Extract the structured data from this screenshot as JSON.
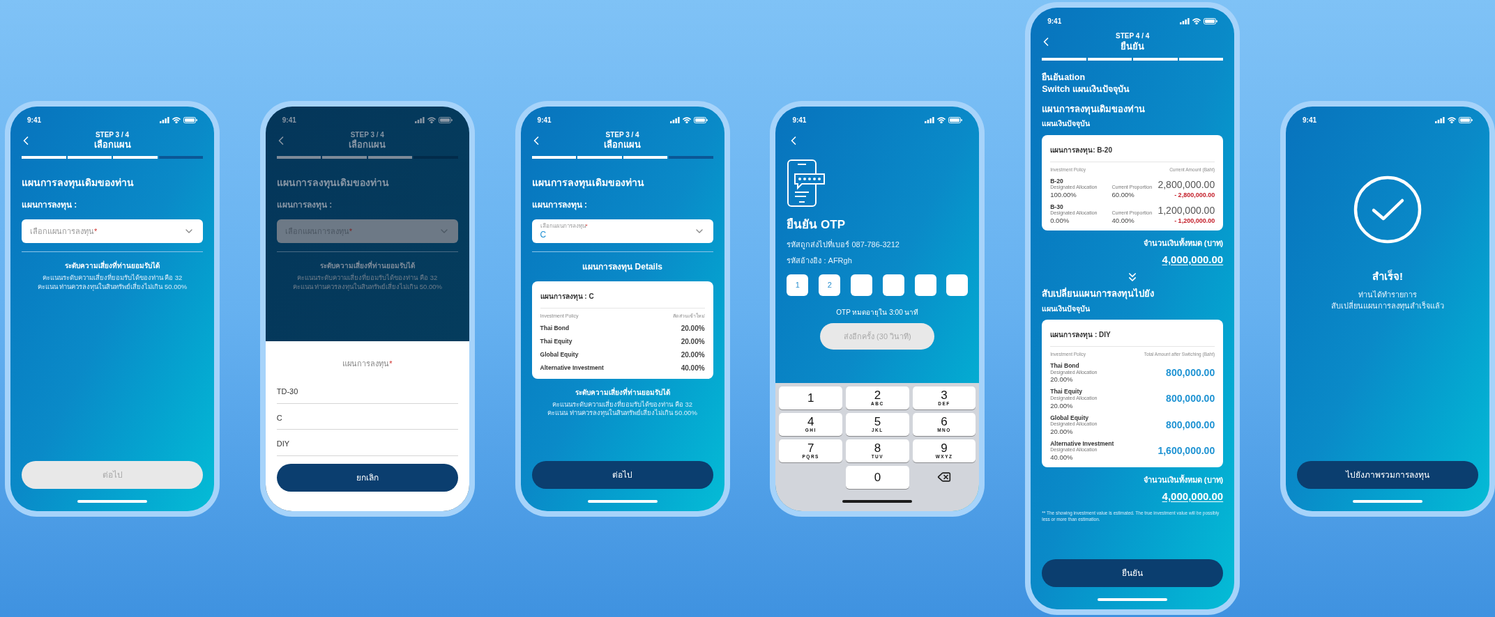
{
  "screens": [
    {
      "kind": "select_plan",
      "dimmed": false,
      "time": "9:41",
      "step": "STEP 3 / 4",
      "title": "เลือกแผน",
      "progress": [
        {
          "done": true
        },
        {
          "done": true
        },
        {
          "done": true
        },
        {
          "done": false
        }
      ],
      "heading": "แผนการลงทุนเดิมของท่าน",
      "field_label": "แผนการลงทุน :",
      "select": {
        "placeholder": "เลือกแผนการลงทุน",
        "required_mark": "*"
      },
      "risk": {
        "title": "ระดับความเสี่ยงที่ท่านยอมรับได้",
        "lines": [
          "คะแนนระดับความเสี่ยงที่ยอมรับได้ของท่าน คือ 32",
          "คะแนน ท่านควรลงทุนในสินทรัพย์เสี่ยงไม่เกิน 50.00%"
        ]
      },
      "button": {
        "label": "ต่อไป",
        "disabled": true
      }
    },
    {
      "kind": "select_plan",
      "dimmed": true,
      "time": "9:41",
      "step": "STEP 3 / 4",
      "title": "เลือกแผน",
      "progress": [
        {
          "done": true
        },
        {
          "done": true
        },
        {
          "done": true
        },
        {
          "done": false
        }
      ],
      "heading": "แผนการลงทุนเดิมของท่าน",
      "field_label": "แผนการลงทุน :",
      "select": {
        "placeholder": "เลือกแผนการลงทุน",
        "required_mark": "*"
      },
      "risk": {
        "title": "ระดับความเสี่ยงที่ท่านยอมรับได้",
        "lines": [
          "คะแนนระดับความเสี่ยงที่ยอมรับได้ของท่าน คือ 32",
          "คะแนน ท่านควรลงทุนในสินทรัพย์เสี่ยงไม่เกิน 50.00%"
        ]
      },
      "sheet": {
        "title": "แผนการลงทุน",
        "required_mark": "*",
        "options": [
          "TD-30",
          "C",
          "DIY"
        ],
        "cancel": "ยกเลิก"
      }
    },
    {
      "kind": "select_plan",
      "dimmed": false,
      "time": "9:41",
      "step": "STEP 3 / 4",
      "title": "เลือกแผน",
      "progress": [
        {
          "done": true
        },
        {
          "done": true
        },
        {
          "done": true
        },
        {
          "done": false
        }
      ],
      "heading": "แผนการลงทุนเดิมของท่าน",
      "field_label": "แผนการลงทุน :",
      "select": {
        "placeholder": "เลือกแผนการลงทุน",
        "required_mark": "*",
        "value": "C"
      },
      "details": {
        "heading": "แผนการลงทุน Details",
        "card_title": "แผนการลงทุน :  C",
        "columns": [
          "Investment Policy",
          "สัดส่วนเข้าใหม่"
        ],
        "rows": [
          {
            "name": "Thai Bond",
            "value": "20.00%"
          },
          {
            "name": "Thai Equity",
            "value": "20.00%"
          },
          {
            "name": "Global Equity",
            "value": "20.00%"
          },
          {
            "name": "Alternative Investment",
            "value": "40.00%"
          }
        ]
      },
      "risk": {
        "title": "ระดับความเสี่ยงที่ท่านยอมรับได้",
        "lines": [
          "คะแนนระดับความเสี่ยงที่ยอมรับได้ของท่าน คือ 32",
          "คะแนน ท่านควรลงทุนในสินทรัพย์เสี่ยงไม่เกิน 50.00%"
        ]
      },
      "button": {
        "label": "ต่อไป",
        "disabled": false
      }
    },
    {
      "kind": "otp",
      "time": "9:41",
      "title": "ยืนยัน OTP",
      "sent_to": "รหัสถูกส่งไปที่เบอร์ 087-786-3212",
      "reference": "รหัสอ้างอิง : AFRgh",
      "otp_boxes": [
        {
          "kind": "digit",
          "digit": "1"
        },
        {
          "kind": "digit",
          "digit": "2"
        },
        {
          "kind": "blank"
        },
        {
          "kind": "blank"
        },
        {
          "kind": "blank"
        },
        {
          "kind": "blank"
        }
      ],
      "expiry": "OTP หมดอายุใน 3:00 นาที",
      "resend": {
        "label": "ส่งอีกครั้ง (30 วินาที)",
        "disabled": true
      },
      "keys": [
        {
          "kind": "digit",
          "digit": "1"
        },
        {
          "kind": "digit",
          "digit": "2",
          "letters": "ABC"
        },
        {
          "kind": "digit",
          "digit": "3",
          "letters": "DEF"
        },
        {
          "kind": "digit",
          "digit": "4",
          "letters": "GHI"
        },
        {
          "kind": "digit",
          "digit": "5",
          "letters": "JKL"
        },
        {
          "kind": "digit",
          "digit": "6",
          "letters": "MNO"
        },
        {
          "kind": "digit",
          "digit": "7",
          "letters": "PQRS"
        },
        {
          "kind": "digit",
          "digit": "8",
          "letters": "TUV"
        },
        {
          "kind": "digit",
          "digit": "9",
          "letters": "WXYZ"
        },
        {
          "kind": "empty"
        },
        {
          "kind": "digit",
          "digit": "0"
        },
        {
          "kind": "backspace"
        }
      ]
    },
    {
      "kind": "confirm",
      "time": "9:41",
      "step": "STEP 4 / 4",
      "title": "ยืนยัน",
      "progress": [
        {
          "done": true
        },
        {
          "done": true
        },
        {
          "done": true
        },
        {
          "done": true
        }
      ],
      "intro_lines": [
        "ยืนยันation",
        "Switch แผนเงินปัจจุบัน"
      ],
      "current": {
        "heading": "แผนการลงทุนเดิมของท่าน",
        "subheading": "แผนเงินปัจจุบัน",
        "card_title": "แผนการลงทุน: B-20",
        "columns": [
          "Investment Policy",
          "Current Amount (Baht)"
        ],
        "rows": [
          {
            "name": "B-20",
            "alloc_label": "Designated Allocation",
            "alloc": "100.00%",
            "prop_label": "Current Proportion",
            "prop": "60.00%",
            "amount": "2,800,000.00",
            "deduction": "- 2,800,000.00"
          },
          {
            "name": "B-30",
            "alloc_label": "Designated Allocation",
            "alloc": "0.00%",
            "prop_label": "Current Proportion",
            "prop": "40.00%",
            "amount": "1,200,000.00",
            "deduction": "- 1,200,000.00"
          }
        ],
        "total_label": "จำนวนเงินทั้งหมด (บาท)",
        "total": "4,000,000.00"
      },
      "target": {
        "heading": "สับเปลี่ยนแผนการลงทุนไปยัง",
        "subheading": "แผนเงินปัจจุบัน",
        "card_title": "แผนการลงทุน :  DIY",
        "columns": [
          "Investment Policy",
          "Total Amount after Switching (Baht)"
        ],
        "rows": [
          {
            "name": "Thai Bond",
            "alloc_label": "Designated Allocation",
            "alloc": "20.00%",
            "amount": "800,000.00"
          },
          {
            "name": "Thai Equity",
            "alloc_label": "Designated Allocation",
            "alloc": "20.00%",
            "amount": "800,000.00"
          },
          {
            "name": "Global Equity",
            "alloc_label": "Designated Allocation",
            "alloc": "20.00%",
            "amount": "800,000.00"
          },
          {
            "name": "Alternative Investment",
            "alloc_label": "Designated Allocation",
            "alloc": "40.00%",
            "amount": "1,600,000.00"
          }
        ],
        "total_label": "จำนวนเงินทั้งหมด (บาท)",
        "total": "4,000,000.00"
      },
      "note": "** The showing investment value is estimated. The true investment value will be possibly less or more than estimation.",
      "button": {
        "label": "ยืนยัน",
        "disabled": false
      }
    },
    {
      "kind": "success",
      "time": "9:41",
      "title": "สำเร็จ!",
      "lines": [
        "ท่านได้ทำรายการ",
        "สับเปลี่ยนแผนการลงทุนสำเร็จแล้ว"
      ],
      "button": {
        "label": "ไปยังภาพรวมการลงทุน",
        "disabled": false
      }
    }
  ]
}
